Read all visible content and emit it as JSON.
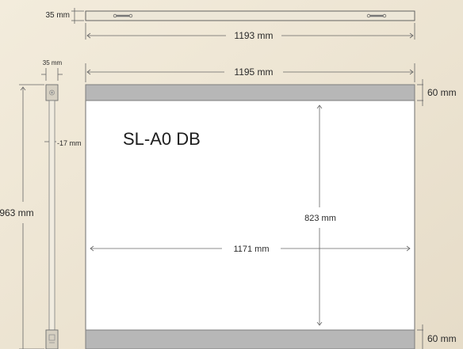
{
  "model": "SL-A0 DB",
  "colors": {
    "background": "#efe8d8",
    "rail": "#b7b7b7",
    "rail_stroke": "#7d7d7d",
    "poster": "#ffffff",
    "line": "#444444"
  },
  "dimensions": {
    "top_bar_height": "35 mm",
    "top_bar_length": "1193 mm",
    "side_profile_width": "35 mm",
    "total_width": "1195 mm",
    "rail_height_top": "60 mm",
    "rail_height_bottom": "60 mm",
    "side_offset": "-17 mm",
    "total_height": "963 mm",
    "visible_height": "823 mm",
    "visible_width": "1171 mm"
  }
}
